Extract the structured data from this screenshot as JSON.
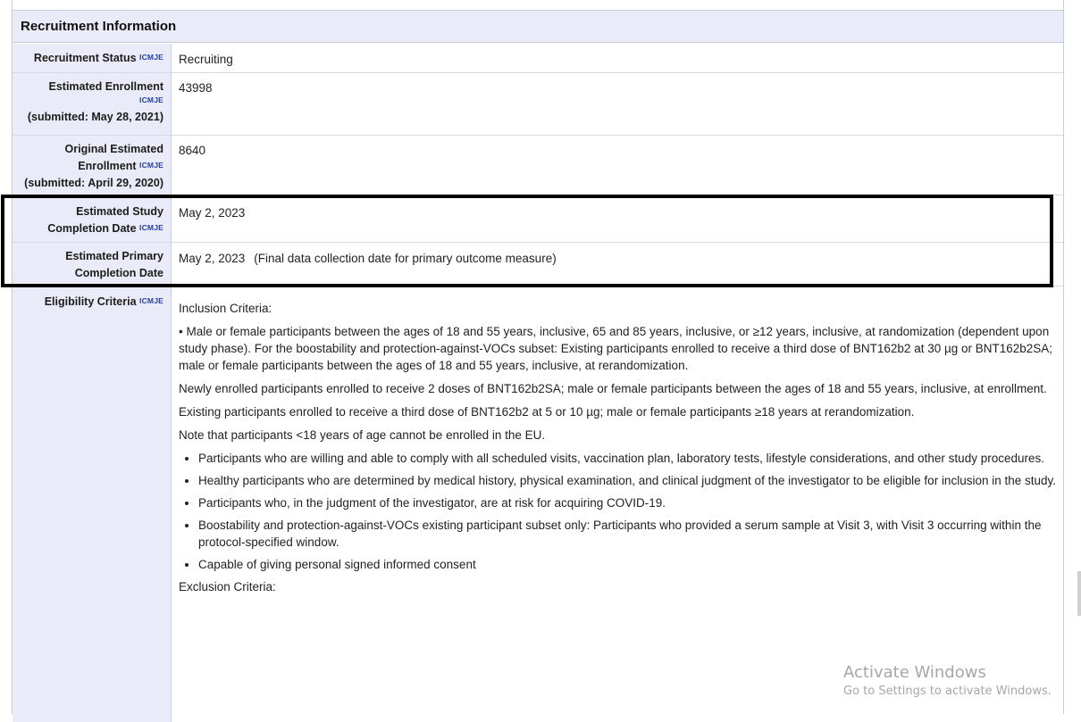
{
  "section": {
    "title": "Recruitment Information"
  },
  "icmje": "ICMJE",
  "rows": {
    "status": {
      "label": "Recruitment Status",
      "value": "Recruiting"
    },
    "enrollment": {
      "label": "Estimated Enrollment",
      "submitted": "(submitted: May 28, 2021)",
      "value": "43998"
    },
    "orig_enrollment": {
      "label1": "Original Estimated",
      "label2": "Enrollment",
      "submitted": "(submitted: April 29, 2020)",
      "value": "8640"
    },
    "study_completion": {
      "label1": "Estimated Study",
      "label2": "Completion Date",
      "value": "May 2, 2023"
    },
    "primary_completion": {
      "label1": "Estimated Primary",
      "label2": "Completion Date",
      "value": "May 2, 2023",
      "note": "(Final data collection date for primary outcome measure)"
    },
    "eligibility": {
      "label": "Eligibility Criteria"
    }
  },
  "eligibility": {
    "inclusion_heading": "Inclusion Criteria:",
    "paragraphs": [
      "• Male or female participants between the ages of 18 and 55 years, inclusive, 65 and 85 years, inclusive, or ≥12 years, inclusive, at randomization (dependent upon study phase). For the boostability and protection-against-VOCs subset: Existing participants enrolled to receive a third dose of BNT162b2 at 30 µg or BNT162b2SA; male or female participants between the ages of 18 and 55 years, inclusive, at rerandomization.",
      "Newly enrolled participants enrolled to receive 2 doses of BNT162b2SA; male or female participants between the ages of 18 and 55 years, inclusive, at enrollment.",
      "Existing participants enrolled to receive a third dose of BNT162b2 at 5 or 10 µg; male or female participants ≥18 years at rerandomization.",
      "Note that participants <18 years of age cannot be enrolled in the EU."
    ],
    "bullets": [
      "Participants who are willing and able to comply with all scheduled visits, vaccination plan, laboratory tests, lifestyle considerations, and other study procedures.",
      "Healthy participants who are determined by medical history, physical examination, and clinical judgment of the investigator to be eligible for inclusion in the study.",
      "Participants who, in the judgment of the investigator, are at risk for acquiring COVID-19.",
      "Boostability and protection-against-VOCs existing participant subset only: Participants who provided a serum sample at Visit 3, with Visit 3 occurring within the protocol-specified window.",
      "Capable of giving personal signed informed consent"
    ],
    "exclusion_heading": "Exclusion Criteria:"
  },
  "watermark": {
    "line1": "Activate Windows",
    "line2": "Go to Settings to activate Windows."
  }
}
